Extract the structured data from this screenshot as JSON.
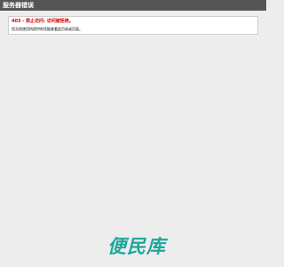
{
  "header": {
    "title": "服务器错误"
  },
  "error": {
    "title": "403 - 禁止访问: 访问被拒绝。",
    "description": "您无权使用所提供的凭据查看此目录或页面。"
  },
  "footer": {
    "logo_text": "便民库",
    "logo_color": "#1ea79a"
  }
}
